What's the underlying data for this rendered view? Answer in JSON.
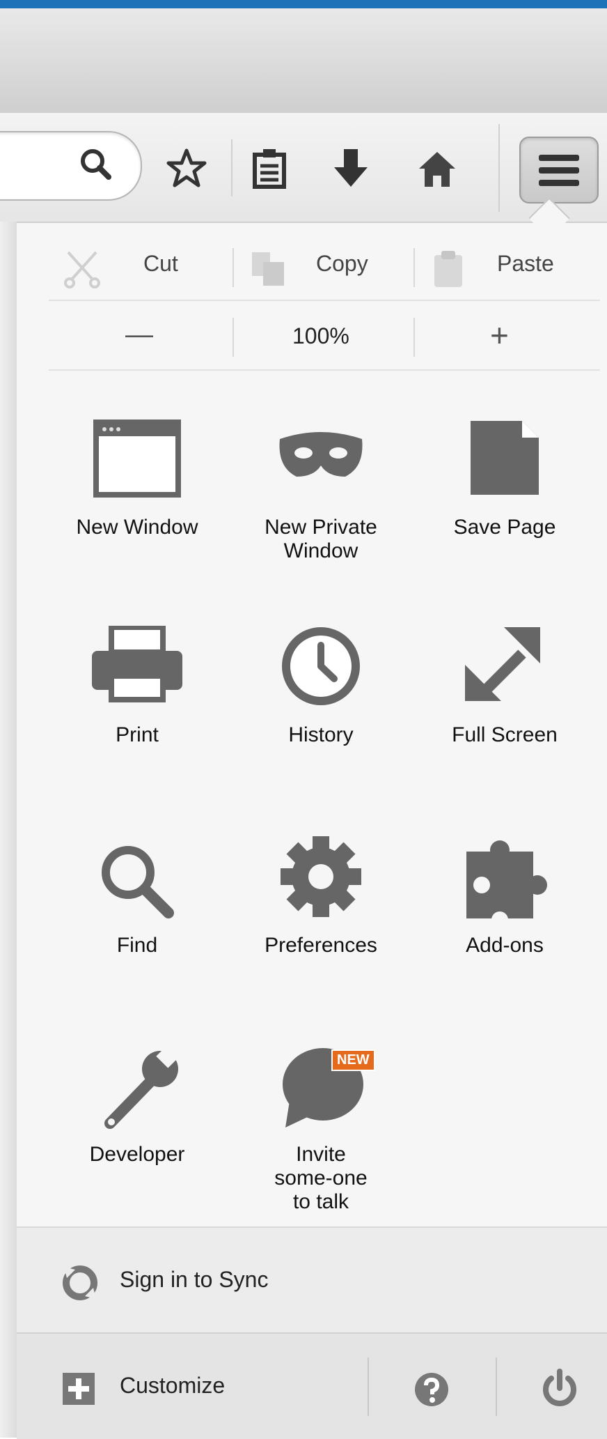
{
  "toolbar": {
    "icons": [
      "search-icon",
      "bookmark-star-icon",
      "reading-list-icon",
      "download-icon",
      "home-icon",
      "hamburger-menu-icon"
    ]
  },
  "edit": {
    "cut": "Cut",
    "copy": "Copy",
    "paste": "Paste"
  },
  "zoom": {
    "minus": "—",
    "level": "100%",
    "plus": "+"
  },
  "grid": {
    "new_window": "New Window",
    "new_private_window": "New Private Window",
    "save_page": "Save Page",
    "print": "Print",
    "history": "History",
    "full_screen": "Full Screen",
    "find": "Find",
    "preferences": "Preferences",
    "addons": "Add-ons",
    "developer": "Developer",
    "invite": "Invite some-one to talk",
    "new_badge": "NEW"
  },
  "footer": {
    "sync": "Sign in to Sync",
    "customize": "Customize"
  },
  "colors": {
    "accent_blue": "#1E72B8",
    "badge": "#E66A1B",
    "icon_gray": "#666666"
  }
}
